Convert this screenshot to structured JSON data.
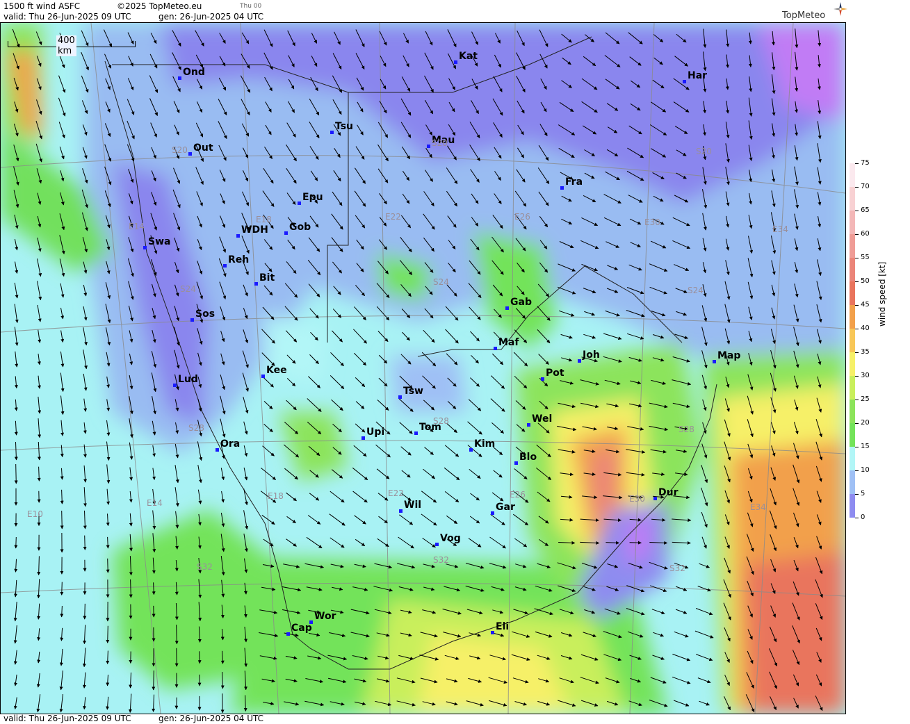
{
  "header": {
    "title": "1500 ft wind ASFC",
    "copyright": "©2025 TopMeteo.eu",
    "small_tag": "Thu 00",
    "valid": "valid:  Thu  26-Jun-2025  09 UTC",
    "gen": "gen:  26-Jun-2025 04 UTC",
    "logo_text": "TopMeteo"
  },
  "footer": {
    "valid": "valid:  Thu  26-Jun-2025  09 UTC",
    "gen": "gen:  26-Jun-2025 04 UTC"
  },
  "scale_bar": {
    "label": "400 km"
  },
  "legend": {
    "title": "wind speed  [kt]",
    "ticks": [
      "75",
      "70",
      "65",
      "60",
      "55",
      "50",
      "45",
      "40",
      "35",
      "30",
      "25",
      "20",
      "15",
      "10",
      "5",
      "0"
    ],
    "colors": [
      "#fbe9ee",
      "#f8d1d3",
      "#f3b7b7",
      "#ef9c96",
      "#eb8579",
      "#e9745d",
      "#f2a04b",
      "#f8c758",
      "#f6f068",
      "#c9ef5c",
      "#8ce45b",
      "#73e35a",
      "#b2f6f7",
      "#9fc0f5",
      "#8e8cf0",
      "#c17cf5"
    ]
  },
  "cities": [
    {
      "name": "Ond"
    },
    {
      "name": "Kat"
    },
    {
      "name": "Har"
    },
    {
      "name": "Tsu"
    },
    {
      "name": "Out"
    },
    {
      "name": "Mau"
    },
    {
      "name": "Fra"
    },
    {
      "name": "Epu"
    },
    {
      "name": "WDH"
    },
    {
      "name": "Gob"
    },
    {
      "name": "Swa"
    },
    {
      "name": "Reh"
    },
    {
      "name": "Bit"
    },
    {
      "name": "Sos"
    },
    {
      "name": "Gab"
    },
    {
      "name": "Maf"
    },
    {
      "name": "Joh"
    },
    {
      "name": "Map"
    },
    {
      "name": "Pot"
    },
    {
      "name": "Lud"
    },
    {
      "name": "Kee"
    },
    {
      "name": "Tsw"
    },
    {
      "name": "Wel"
    },
    {
      "name": "Upi"
    },
    {
      "name": "Tom"
    },
    {
      "name": "Ora"
    },
    {
      "name": "Kim"
    },
    {
      "name": "Blo"
    },
    {
      "name": "Dur"
    },
    {
      "name": "Wil"
    },
    {
      "name": "Gar"
    },
    {
      "name": "Vog"
    },
    {
      "name": "Wor"
    },
    {
      "name": "Cap"
    },
    {
      "name": "Eli"
    }
  ],
  "grid_labels": [
    "S20",
    "S20",
    "S20",
    "E14",
    "E18",
    "E22",
    "E26",
    "E30",
    "E34",
    "S24",
    "S24",
    "S24",
    "S28",
    "S28",
    "S28",
    "E10",
    "E14",
    "E18",
    "E22",
    "E26",
    "E30",
    "E34",
    "S32",
    "S32",
    "S32"
  ]
}
